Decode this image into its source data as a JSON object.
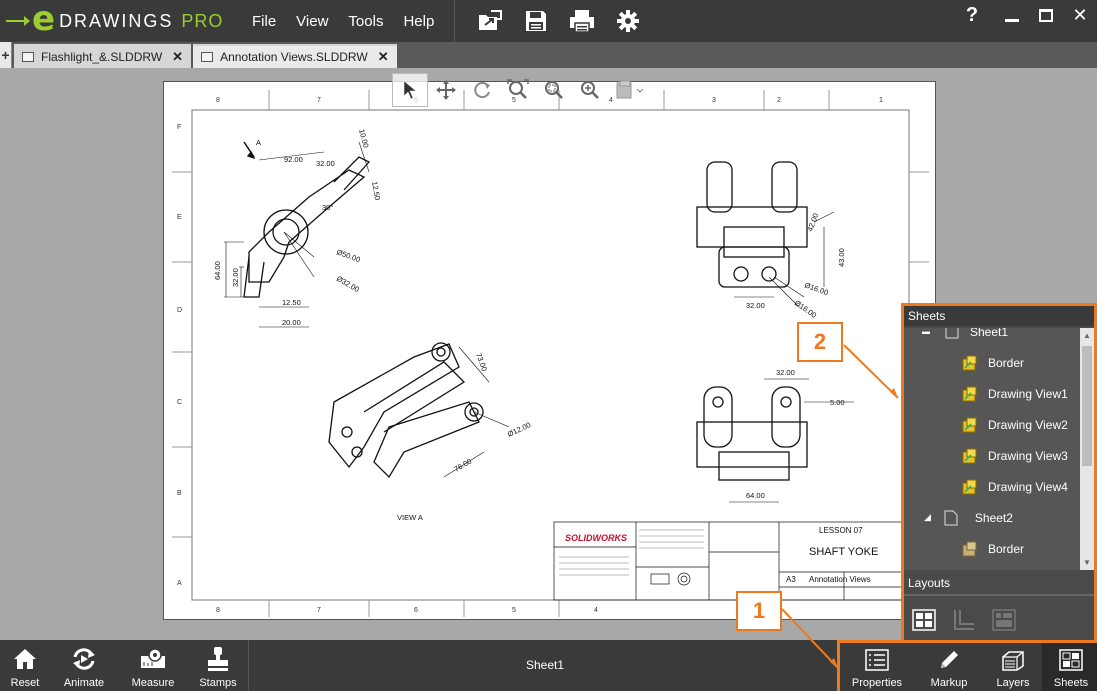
{
  "app": {
    "logo_word": "DRAWINGS",
    "logo_suffix": "PRO",
    "logo_mark": "e",
    "accent_color": "#9ccc30",
    "highlight_color": "#ee7a1f"
  },
  "menu": [
    "File",
    "View",
    "Tools",
    "Help"
  ],
  "toolbar_icons": [
    "open-icon",
    "save-icon",
    "print-icon",
    "settings-gear-icon"
  ],
  "window_controls": {
    "help": "?",
    "minimize": "—",
    "maximize": "☐",
    "close": "✕"
  },
  "tabs": [
    {
      "label": "Flashlight_&.SLDDRW",
      "close": "✕"
    },
    {
      "label": "Annotation Views.SLDDRW",
      "close": "✕"
    }
  ],
  "tab_add": "+",
  "view_toolbar_icons": [
    "select-arrow-icon",
    "pan-icon",
    "rotate-icon",
    "zoom-to-fit-icon",
    "zoom-area-icon",
    "zoom-in-out-icon",
    "display-mode-icon"
  ],
  "drawing": {
    "top_zones": [
      "8",
      "7",
      "6",
      "5",
      "4",
      "3",
      "2",
      "1"
    ],
    "bottom_zones": [
      "8",
      "7",
      "6",
      "5",
      "4"
    ],
    "left_zones": [
      "F",
      "E",
      "D",
      "C",
      "B",
      "A"
    ],
    "view_label": "VIEW A",
    "direction_label": "A",
    "dimensions": {
      "iso": [
        "92.00",
        "32.00",
        "10.00",
        "12.50",
        "30°",
        "Ø50.00",
        "Ø32.00",
        "64.00",
        "32.00",
        "12.50",
        "20.00"
      ],
      "front": [
        "42.00",
        "43.00",
        "Ø16.00",
        "Ø16.00",
        "32.00"
      ],
      "iso2": [
        "73.00",
        "Ø12.00",
        "76.00"
      ],
      "top": [
        "32.00",
        "5.00",
        "64.00"
      ]
    },
    "title_block": {
      "brand": "SOLIDWORKS",
      "lesson": "LESSON 07",
      "title": "SHAFT YOKE",
      "size": "A3",
      "name": "Annotation Views"
    }
  },
  "sheets_panel": {
    "header": "Sheets",
    "items": [
      {
        "label": "Sheet1",
        "icon": "sheet-icon"
      },
      {
        "label": "Border",
        "icon": "border-view-icon"
      },
      {
        "label": "Drawing View1",
        "icon": "drawing-view-icon"
      },
      {
        "label": "Drawing View2",
        "icon": "drawing-view-icon"
      },
      {
        "label": "Drawing View3",
        "icon": "drawing-view-icon"
      },
      {
        "label": "Drawing View4",
        "icon": "drawing-view-icon"
      },
      {
        "label": "Sheet2",
        "icon": "sheet-icon"
      },
      {
        "label": "Border",
        "icon": "border-view-icon"
      }
    ],
    "layouts_header": "Layouts",
    "layout_icons": [
      "layout-tiles-icon",
      "layout-l-icon",
      "layout-grid-icon"
    ]
  },
  "bottom_tools": [
    {
      "label": "Reset",
      "icon": "home-icon"
    },
    {
      "label": "Animate",
      "icon": "animate-icon"
    },
    {
      "label": "Measure",
      "icon": "measure-icon"
    },
    {
      "label": "Stamps",
      "icon": "stamp-icon"
    }
  ],
  "current_sheet": "Sheet1",
  "right_tools": [
    {
      "label": "Properties",
      "icon": "properties-icon"
    },
    {
      "label": "Markup",
      "icon": "pencil-icon"
    },
    {
      "label": "Layers",
      "icon": "layers-icon"
    },
    {
      "label": "Sheets",
      "icon": "sheets-icon"
    }
  ],
  "callouts": [
    "1",
    "2"
  ]
}
